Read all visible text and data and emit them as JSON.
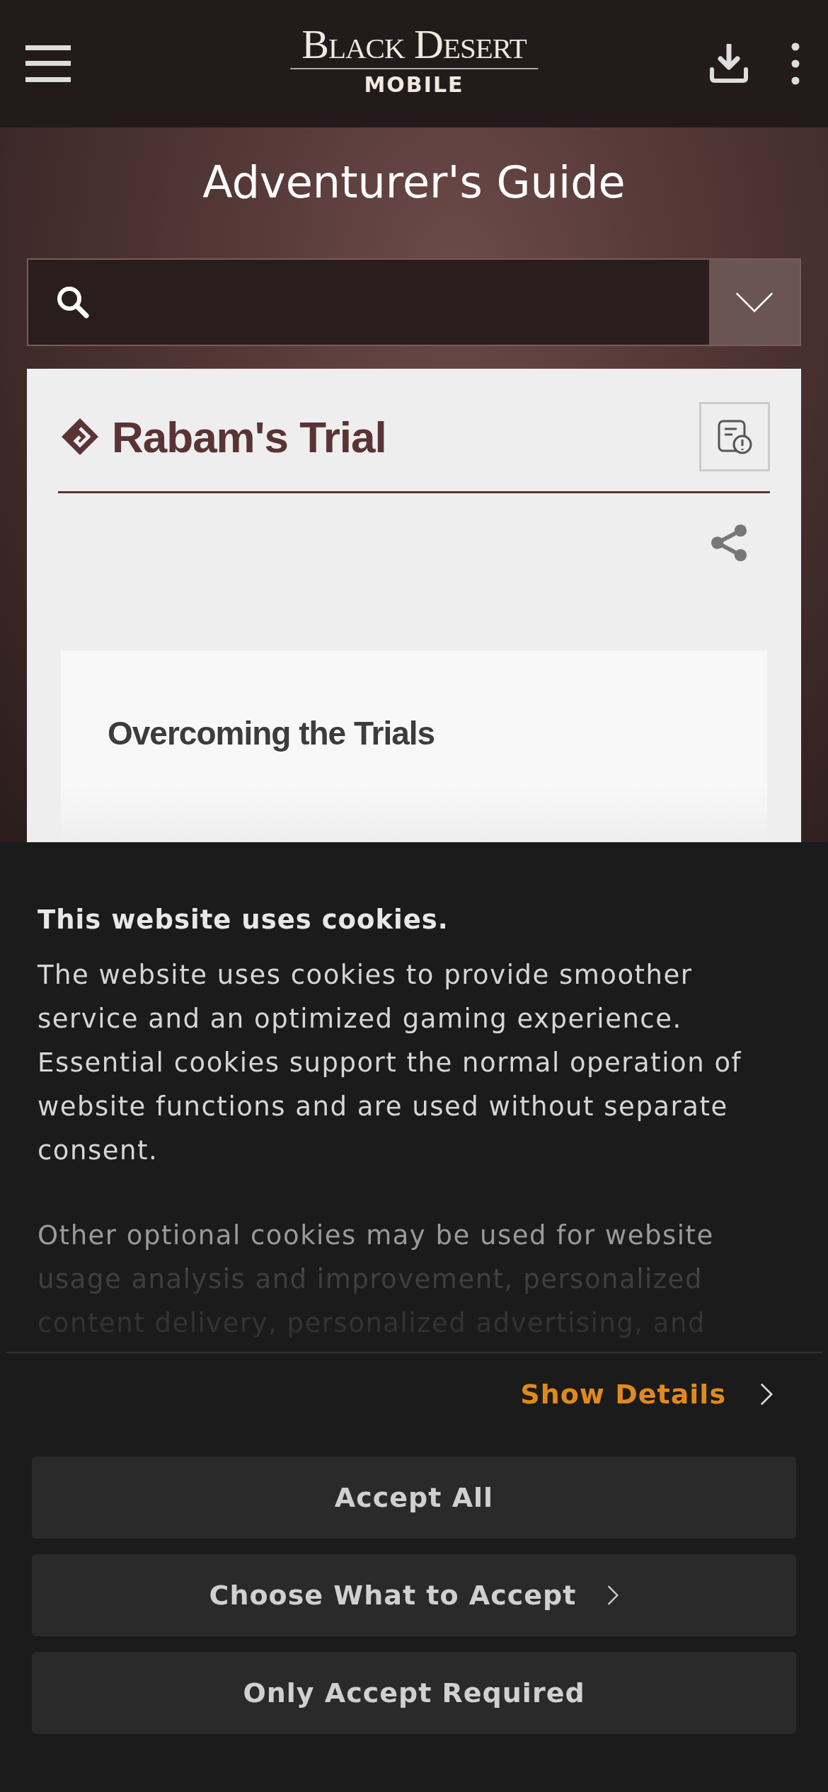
{
  "header": {
    "logo": {
      "title": "Black Desert",
      "subtitle": "MOBILE"
    }
  },
  "page_title": "Adventurer's Guide",
  "article": {
    "title": "Rabam's Trial",
    "section_heading": "Overcoming the Trials"
  },
  "cookie_banner": {
    "heading": "This website uses cookies.",
    "paragraphs": [
      "The website uses cookies to provide smoother service and an optimized gaming experience. Essential cookies support the normal operation of website functions and are used without separate consent.",
      "Other optional cookies may be used for website usage analysis and improvement, personalized content delivery, personalized advertising, and"
    ],
    "details_link": "Show Details",
    "buttons": [
      {
        "label": "Accept All",
        "chevron": false
      },
      {
        "label": "Choose What to Accept",
        "chevron": true
      },
      {
        "label": "Only Accept Required",
        "chevron": false
      }
    ]
  }
}
